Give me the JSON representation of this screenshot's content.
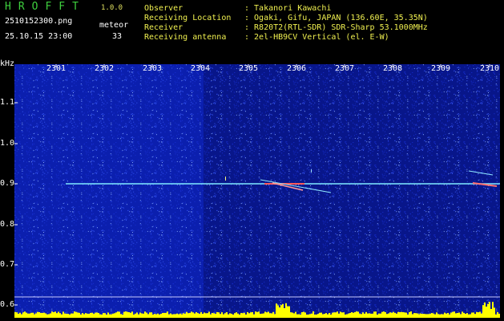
{
  "header": {
    "app_title": "HROFFT",
    "version": "1.0.0",
    "filename": "2510152300.png",
    "datetime": "25.10.15 23:00",
    "meteor_label": "meteor",
    "meteor_count": "33",
    "info": [
      {
        "label": "Observer",
        "value": ": Takanori Kawachi"
      },
      {
        "label": "Receiving Location",
        "value": ": Ogaki, Gifu, JAPAN (136.60E, 35.35N)"
      },
      {
        "label": "Receiver",
        "value": ": R820T2(RTL-SDR) SDR-Sharp 53.1000MHz"
      },
      {
        "label": "Receiving antenna",
        "value": ": 2el-HB9CV Vertical (el. E-W)"
      }
    ]
  },
  "spectrogram": {
    "y_unit": "kHz",
    "y_ticks": [
      "1.1",
      "1.0",
      "0.9",
      "0.8",
      "0.7",
      "0.6"
    ],
    "x_ticks": [
      "2301",
      "2302",
      "2303",
      "2304",
      "2305",
      "2306",
      "2307",
      "2308",
      "2309",
      "2310"
    ],
    "colors": {
      "background": "#0a1aa0",
      "carrier": "#7fe8ff",
      "level": "#ffff00"
    }
  }
}
